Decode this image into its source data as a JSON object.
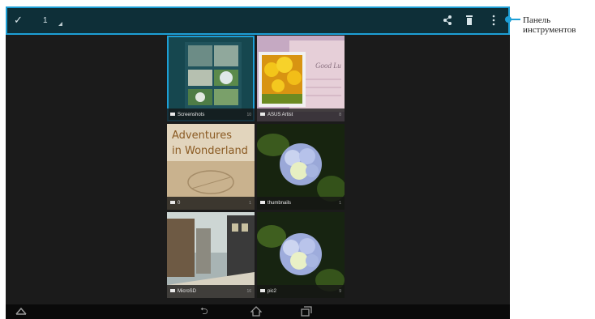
{
  "toolbar": {
    "selected_count": "1"
  },
  "callout": {
    "text": "Панель\nинструментов"
  },
  "tiles": [
    {
      "label": "Screenshots",
      "count": "10"
    },
    {
      "label": "ASUS Artist",
      "count": "8"
    },
    {
      "label": "0",
      "count": "1"
    },
    {
      "label": "thumbnails",
      "count": "1"
    },
    {
      "label": "MicroSD",
      "count": "16"
    },
    {
      "label": "pic2",
      "count": "9"
    }
  ],
  "tile_texts": {
    "postcard": "Good Lu",
    "book_title": "Adventures\nin Wonderland"
  },
  "colors": {
    "accent": "#1d9fd6",
    "toolbar_bg": "#0e2f38",
    "screen_bg": "#1b1b1b"
  },
  "icons": [
    "check-icon",
    "share-icon",
    "trash-icon",
    "overflow-menu-icon",
    "folder-icon",
    "rotate-icon",
    "back-icon",
    "home-icon",
    "recent-apps-icon"
  ]
}
